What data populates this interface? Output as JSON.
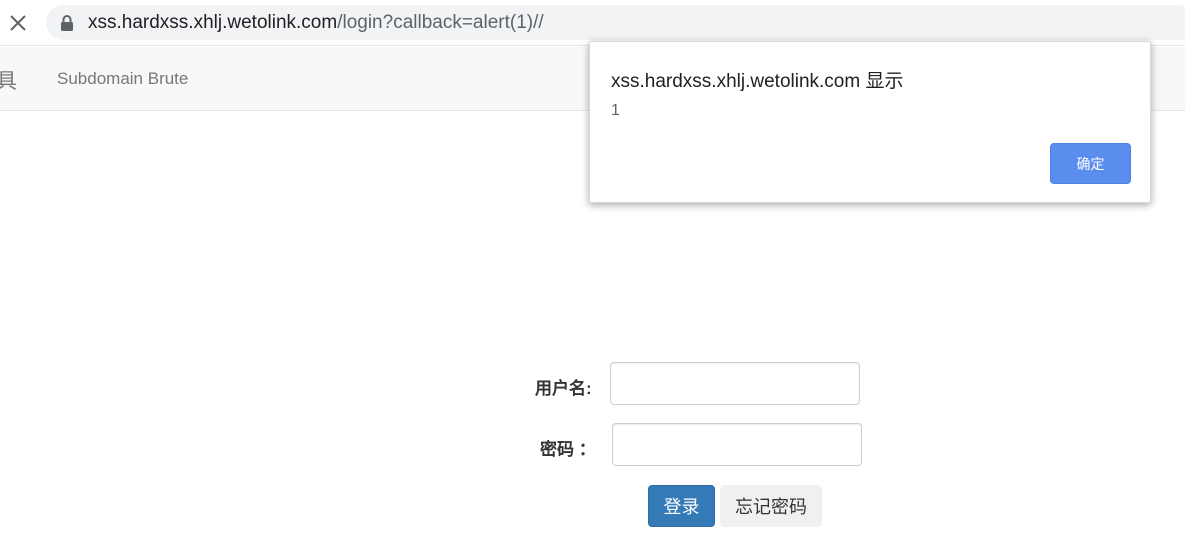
{
  "browser": {
    "url_host": "xss.hardxss.xhlj.wetolink.com",
    "url_path": "/login?callback=alert(1)//"
  },
  "navbar": {
    "cut_brand": "具",
    "link_subdomain": "Subdomain Brute"
  },
  "login": {
    "username_label": "用户名:",
    "password_label": "密码 ：",
    "username_value": "",
    "password_value": "",
    "login_button": "登录",
    "forgot_button": "忘记密码"
  },
  "alert": {
    "title": "xss.hardxss.xhlj.wetolink.com 显示",
    "message": "1",
    "ok_button": "确定"
  },
  "colors": {
    "primary": "#337ab7",
    "dialog_ok": "#5b8def"
  }
}
